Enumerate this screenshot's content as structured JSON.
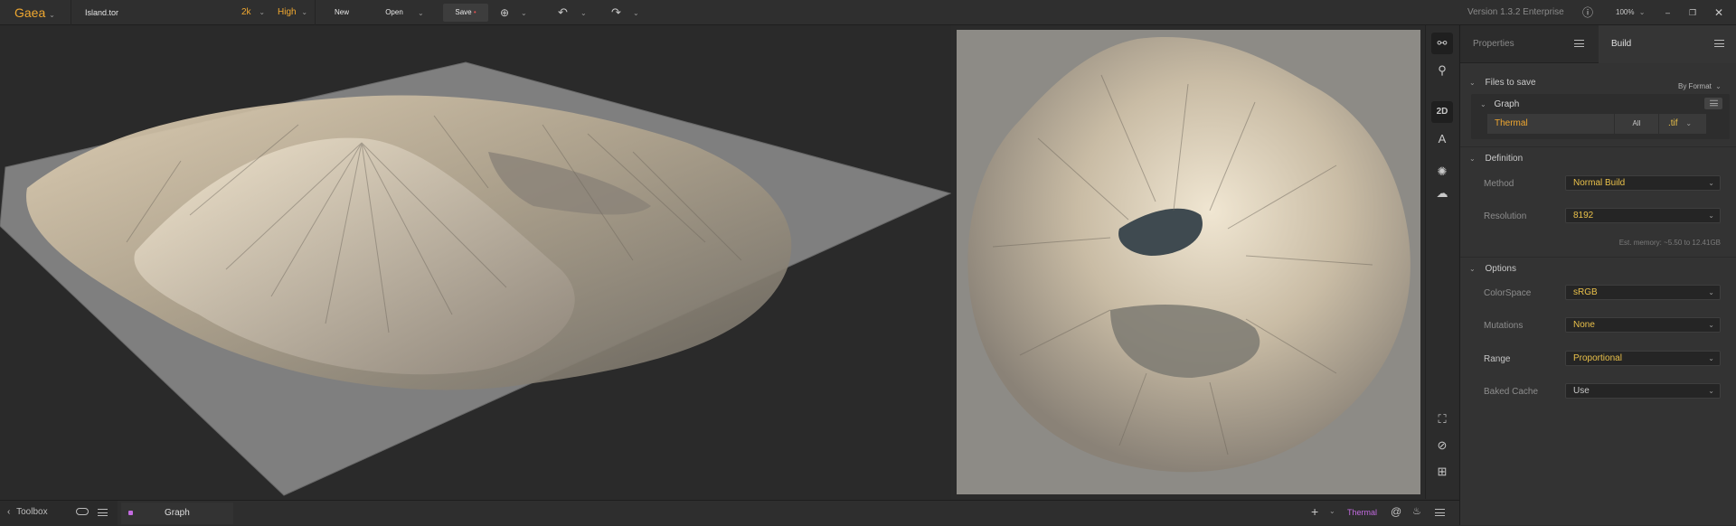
{
  "topbar": {
    "app_name": "Gaea",
    "file_name": "Island.tor",
    "resolution": "2k",
    "quality": "High",
    "new_label": "New",
    "open_label": "Open",
    "save_label": "Save",
    "version": "Version 1.3.2 Enterprise",
    "zoom": "100%",
    "save_dot": "•"
  },
  "viewports": {
    "view2d_toggle": "2D"
  },
  "panel": {
    "tabs": [
      {
        "label": "Properties",
        "active": false
      },
      {
        "label": "Build",
        "active": true
      }
    ],
    "files_to_save": {
      "title": "Files to save",
      "by_format": "By Format",
      "graph": {
        "title": "Graph",
        "node": "Thermal",
        "scope": "All",
        "format": ".tif"
      }
    },
    "definition": {
      "title": "Definition",
      "method_label": "Method",
      "method_value": "Normal Build",
      "resolution_label": "Resolution",
      "resolution_value": "8192",
      "memory_note": "Est. memory: ~5.50 to 12.41GB"
    },
    "options": {
      "title": "Options",
      "colorspace_label": "ColorSpace",
      "colorspace_value": "sRGB",
      "mutations_label": "Mutations",
      "mutations_value": "None",
      "range_label": "Range",
      "range_value": "Proportional",
      "baked_label": "Baked Cache",
      "baked_value": "Use"
    }
  },
  "bottombar": {
    "toolbox_label": "Toolbox",
    "graph_tab": "Graph",
    "active_node": "Thermal"
  },
  "colors": {
    "accent_orange": "#f0a830",
    "accent_yellow": "#e9c04a",
    "node_purple": "#c36be0"
  }
}
